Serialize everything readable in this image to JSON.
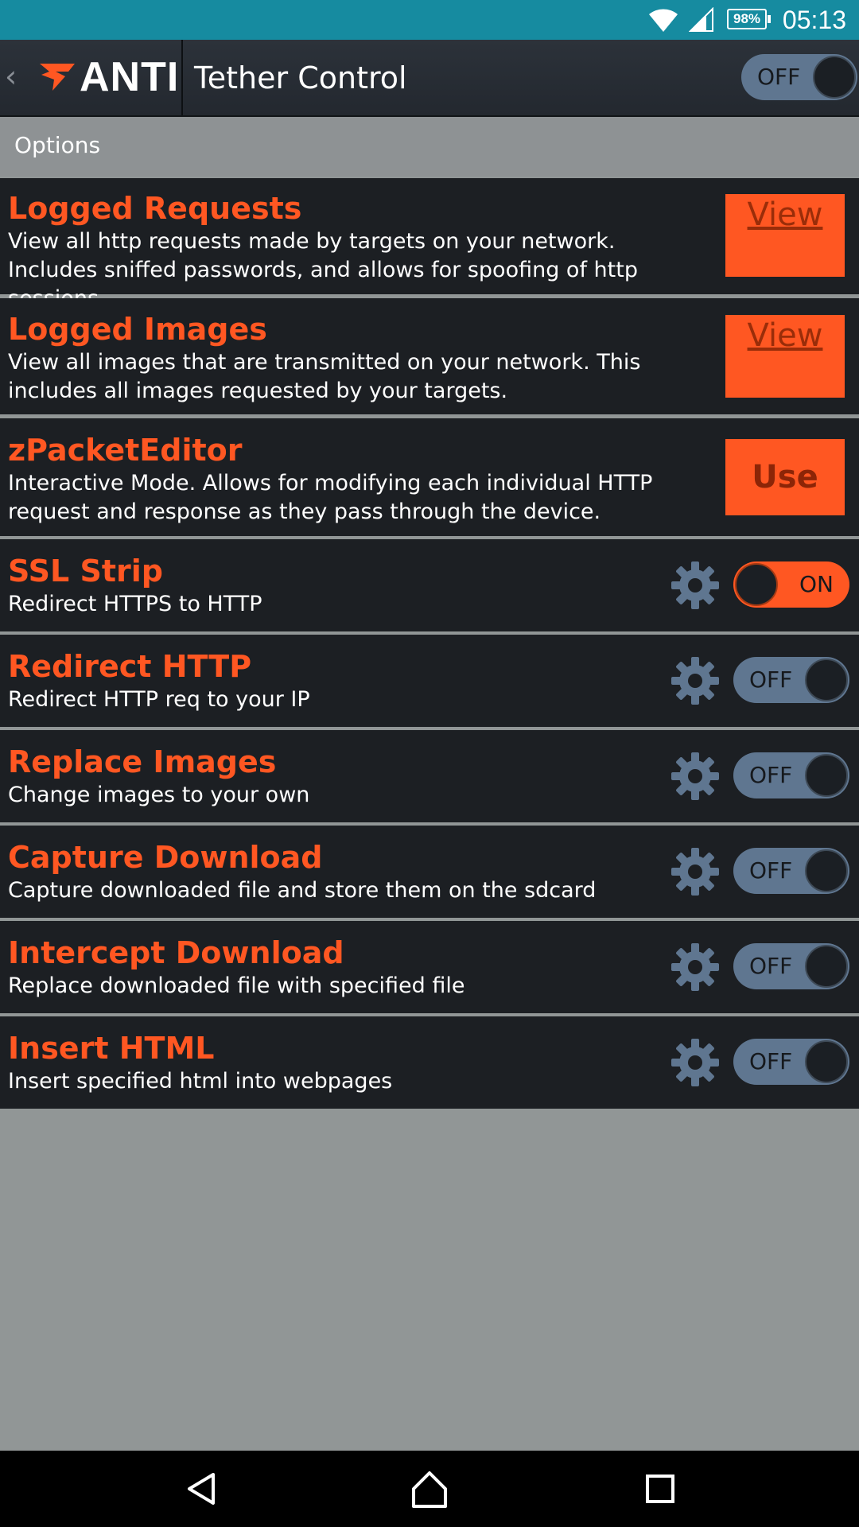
{
  "status_bar": {
    "battery": "98%",
    "time": "05:13",
    "icons": [
      "wifi-icon",
      "cell-signal-icon",
      "battery-icon"
    ]
  },
  "action_bar": {
    "back_glyph": "‹",
    "logo_text": "ANTI",
    "title": "Tether Control",
    "master_toggle": "OFF"
  },
  "options": {
    "header": "Options"
  },
  "rows": [
    {
      "title": "Logged Requests",
      "description": "View all http requests made by targets on your network. Includes sniffed passwords, and allows for spoofing of http sessions.",
      "action": "View"
    },
    {
      "title": "Logged Images",
      "description": "View all images that are transmitted on your network. This includes all images requested by your targets.",
      "action": "View"
    },
    {
      "title": "zPacketEditor",
      "description": "Interactive Mode. Allows for modifying each individual HTTP request and response as they pass through the device.",
      "action": "Use"
    },
    {
      "title": "SSL Strip",
      "description": "Redirect HTTPS to HTTP",
      "toggle": "ON"
    },
    {
      "title": "Redirect HTTP",
      "description": "Redirect HTTP req to your IP",
      "toggle": "OFF"
    },
    {
      "title": "Replace Images",
      "description": "Change images to your own",
      "toggle": "OFF"
    },
    {
      "title": "Capture Download",
      "description": "Capture downloaded file and store them on the sdcard",
      "toggle": "OFF"
    },
    {
      "title": "Intercept Download",
      "description": "Replace downloaded file with specified file",
      "toggle": "OFF"
    },
    {
      "title": "Insert HTML",
      "description": "Insert specified html into webpages",
      "toggle": "OFF"
    }
  ],
  "colors": {
    "accent": "#ff5722",
    "status_bar": "#168ba0",
    "row_background": "#1c1f23",
    "page_background": "#919696",
    "toggle_off": "#5f7690"
  },
  "nav_bar": {
    "icons": [
      "back-nav-icon",
      "home-nav-icon",
      "recents-nav-icon"
    ]
  }
}
